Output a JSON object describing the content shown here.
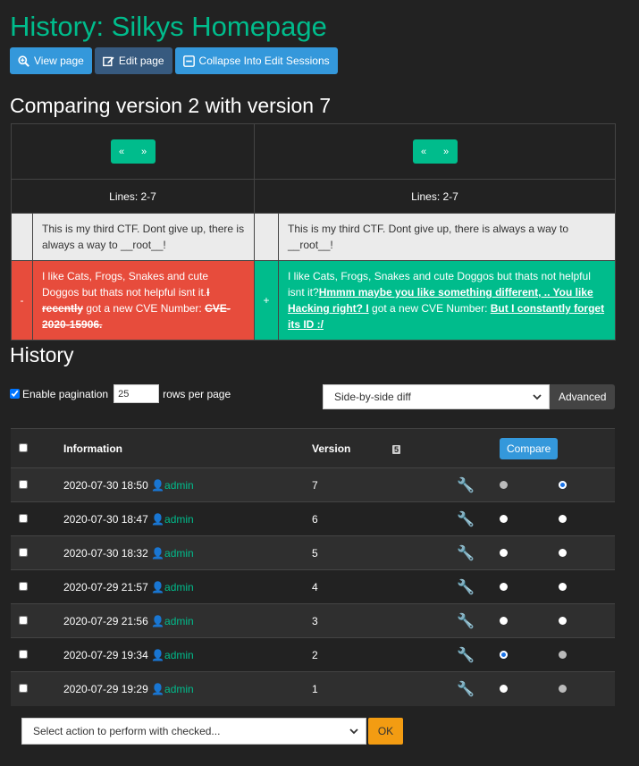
{
  "page": {
    "title": "History: Silkys Homepage",
    "buttons": {
      "view": "View page",
      "edit": "Edit page",
      "collapse": "Collapse Into Edit Sessions"
    },
    "compare_heading": "Comparing version 2 with version 7"
  },
  "diff": {
    "prev_label": "«",
    "next_label": "»",
    "left_lines": "Lines: 2-7",
    "right_lines": "Lines: 2-7",
    "context_left": "This is my third CTF. Dont give up, there is always a way to __root__!",
    "context_right": "This is my third CTF. Dont give up, there is always a way to __root__!",
    "del_mark": "-",
    "ins_mark": "+",
    "left_a": "I like Cats, Frogs, Snakes and cute Doggos but thats not helpful isnt it.",
    "left_del1": "I recently",
    "left_b": " got a new CVE Number: ",
    "left_del2": "CVE-2020-15906.",
    "right_a": "I like Cats, Frogs, Snakes and cute Doggos but thats not helpful isnt it?",
    "right_ins1": "Hmmm maybe you like something different, .. You like Hacking right? I",
    "right_b": " got a new CVE Number: ",
    "right_ins2": "But I constantly forget its ID :/"
  },
  "history": {
    "heading": "History",
    "pagination_label": "Enable pagination",
    "rows_per_page": "25",
    "rows_per_page_label": "rows per page",
    "view_mode": "Side-by-side diff",
    "advanced": "Advanced",
    "col_information": "Information",
    "col_version": "Version",
    "compare": "Compare",
    "rows": [
      {
        "date": "2020-07-30 18:50",
        "user": "admin",
        "version": "7"
      },
      {
        "date": "2020-07-30 18:47",
        "user": "admin",
        "version": "6"
      },
      {
        "date": "2020-07-30 18:32",
        "user": "admin",
        "version": "5"
      },
      {
        "date": "2020-07-29 21:57",
        "user": "admin",
        "version": "4"
      },
      {
        "date": "2020-07-29 21:56",
        "user": "admin",
        "version": "3"
      },
      {
        "date": "2020-07-29 19:34",
        "user": "admin",
        "version": "2"
      },
      {
        "date": "2020-07-29 19:29",
        "user": "admin",
        "version": "1"
      }
    ],
    "bulk_action": "Select action to perform with checked...",
    "ok": "OK"
  }
}
